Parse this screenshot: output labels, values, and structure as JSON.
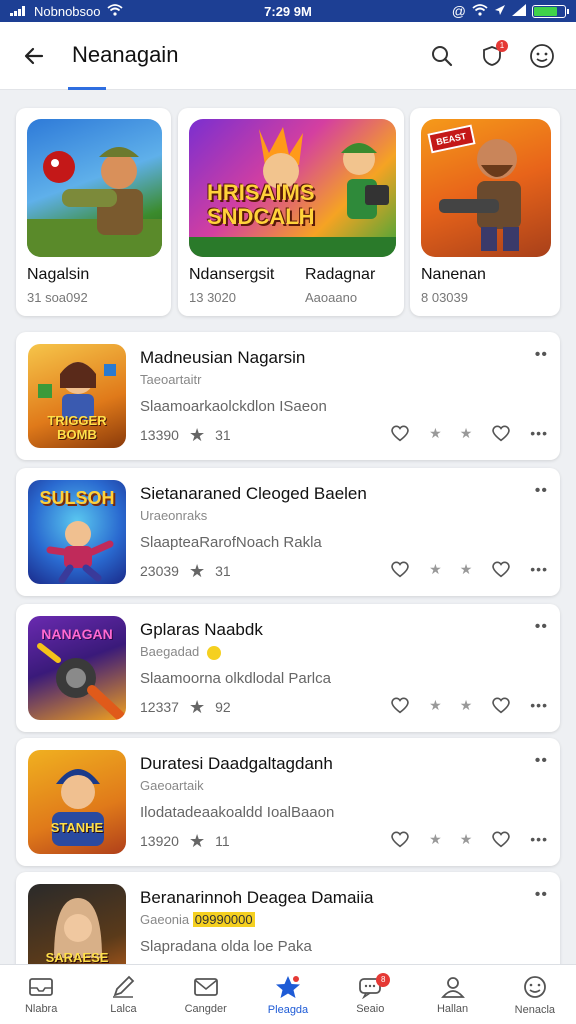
{
  "status": {
    "carrier": "Nobnobsoo",
    "time": "7:29 9M"
  },
  "header": {
    "title": "Neanagain",
    "notif_badge": "1"
  },
  "featured": [
    {
      "name": "Nagalsin",
      "sub": "31 soa092",
      "image": "soldier-with-red-blaster"
    },
    {
      "name": "Ndansergsit",
      "name2": "Radagnar",
      "sub": "13 3020",
      "sub2": "Aaoaano",
      "image_text": "HRISAIMS SNDCALH",
      "image": "flame-hero-and-mechanic"
    },
    {
      "name": "Nanenan",
      "sub": "8 03039",
      "image_badge": "BEAST",
      "image": "bearded-gunner"
    }
  ],
  "rows": [
    {
      "title": "Madneusian Nagarsin",
      "category": "Taeoartaitr",
      "desc": "Slaamoarkaolckdlon ISaeon",
      "count": "13390",
      "rating": "31",
      "thumb_text": "TRIGGER BOMB",
      "image": "heroine-with-treasure"
    },
    {
      "title": "Sietanaraned Cleoged Baelen",
      "category": "Uraeonraks",
      "desc": "SlaapteaRarofNoach Rakla",
      "count": "23039",
      "rating": "31",
      "thumb_text": "SULSOH",
      "image": "flying-superhero"
    },
    {
      "title": "Gplaras Naabdk",
      "category": "Baegadad",
      "desc": "Slaamoorna olkdlodal Parlca",
      "count": "12337",
      "rating": "92",
      "thumb_text": "NANAGAN",
      "image": "cannon-blast"
    },
    {
      "title": "Duratesi Daadgaltagdanh",
      "category": "Gaeoartaik",
      "desc": "Ilodatadeaakoaldd IoalBaaon",
      "count": "13920",
      "rating": "11",
      "thumb_text": "STANHE",
      "image": "hooded-boy"
    },
    {
      "title": "Beranarinnoh Deagea Damaiia",
      "category": "Gaeonia",
      "category_highlight": "09990000",
      "desc": "Slapradana olda loe Paka",
      "count": "",
      "rating": "",
      "thumb_text": "SARAESE",
      "image": "hijab-character"
    }
  ],
  "nav": [
    {
      "label": "Nlabra",
      "icon": "inbox-icon"
    },
    {
      "label": "Lalca",
      "icon": "pen-icon"
    },
    {
      "label": "Cangder",
      "icon": "mail-icon"
    },
    {
      "label": "Pleagda",
      "icon": "star-icon",
      "active": true
    },
    {
      "label": "Seaio",
      "icon": "chat-icon",
      "badge": "8"
    },
    {
      "label": "Hallan",
      "icon": "person-icon"
    },
    {
      "label": "Nenacla",
      "icon": "smiley-icon"
    }
  ],
  "colors": {
    "status_bar": "#1d3f94",
    "accent": "#2f6ee0",
    "active_nav": "#1e5bd6",
    "badge": "#e53935"
  }
}
